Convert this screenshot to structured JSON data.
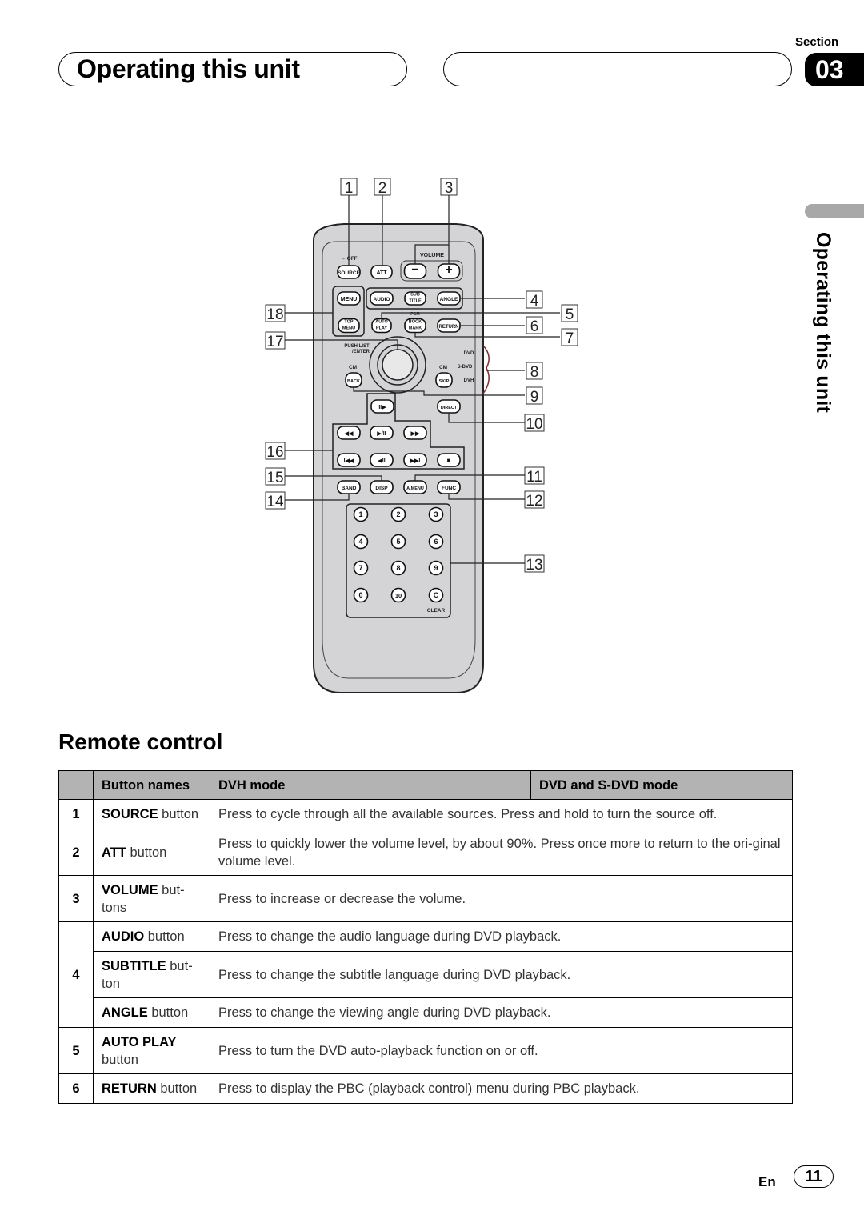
{
  "header": {
    "title": "Operating this unit",
    "section_label": "Section",
    "section_number": "03"
  },
  "side_tab": {
    "label": "Operating this unit"
  },
  "remote": {
    "callouts": [
      "1",
      "2",
      "3",
      "4",
      "5",
      "6",
      "7",
      "8",
      "9",
      "10",
      "11",
      "12",
      "13",
      "14",
      "15",
      "16",
      "17",
      "18"
    ],
    "labels": {
      "source_off": "↔ OFF",
      "volume": "VOLUME",
      "push_list": "PUSH LIST",
      "enter": "/ENTER",
      "cm_left": "CM",
      "cm_right": "CM",
      "dvd": "DVD",
      "s_dvd": "S-DVD",
      "dvh": "DVH",
      "clear": "CLEAR",
      "pgm": "PGM"
    },
    "buttons": {
      "source": "SOURCE",
      "att": "ATT",
      "vol_minus": "−",
      "vol_plus": "+",
      "menu": "MENU",
      "audio": "AUDIO",
      "subtitle_1": "SUB",
      "subtitle_2": "TITLE",
      "angle": "ANGLE",
      "top_menu_1": "TOP",
      "top_menu_2": "MENU",
      "auto_play_1": "AUTO",
      "auto_play_2": "PLAY",
      "bookmark_1": "BOOK",
      "bookmark_2": "MARK",
      "return": "RETURN",
      "back": "BACK",
      "skip": "SKIP",
      "slow": "II▶",
      "direct": "DIRECT",
      "rew": "◀◀",
      "play_pause": "▶/II",
      "ff": "▶▶",
      "prev": "I◀◀",
      "step_back": "◀II",
      "next": "▶▶I",
      "stop": "■",
      "band": "BAND",
      "disp": "DISP",
      "amenu": "A.MENU",
      "func": "FUNC",
      "keypad": [
        "1",
        "2",
        "3",
        "4",
        "5",
        "6",
        "7",
        "8",
        "9",
        "0",
        "10",
        "C"
      ]
    }
  },
  "section_heading": "Remote control",
  "table": {
    "headers": [
      "",
      "Button names",
      "DVH mode",
      "DVD and S-DVD mode"
    ],
    "rows": [
      {
        "num": "1",
        "name_bold": "SOURCE",
        "name_rest": " button",
        "desc": "Press to cycle through all the available sources. Press and hold to turn the source off."
      },
      {
        "num": "2",
        "name_bold": "ATT",
        "name_rest": " button",
        "desc": "Press to quickly lower the volume level, by about 90%. Press once more to return to the ori-ginal volume level."
      },
      {
        "num": "3",
        "name_bold": "VOLUME",
        "name_rest": " but-tons",
        "desc": "Press to increase or decrease the volume."
      },
      {
        "num": "4",
        "name_bold": "AUDIO",
        "name_rest": " button",
        "desc": "Press to change the audio language during DVD playback."
      },
      {
        "num": "",
        "name_bold": "SUBTITLE",
        "name_rest": " but-ton",
        "desc": "Press to change the subtitle language during DVD playback."
      },
      {
        "num": "",
        "name_bold": "ANGLE",
        "name_rest": " button",
        "desc": "Press to change the viewing angle during DVD playback."
      },
      {
        "num": "5",
        "name_bold": "AUTO PLAY",
        "name_rest": " button",
        "desc": "Press to turn the DVD auto-playback function on or off."
      },
      {
        "num": "6",
        "name_bold": "RETURN",
        "name_rest": " button",
        "desc": "Press to display the PBC (playback control) menu during PBC playback."
      }
    ]
  },
  "footer": {
    "lang": "En",
    "page": "11"
  }
}
